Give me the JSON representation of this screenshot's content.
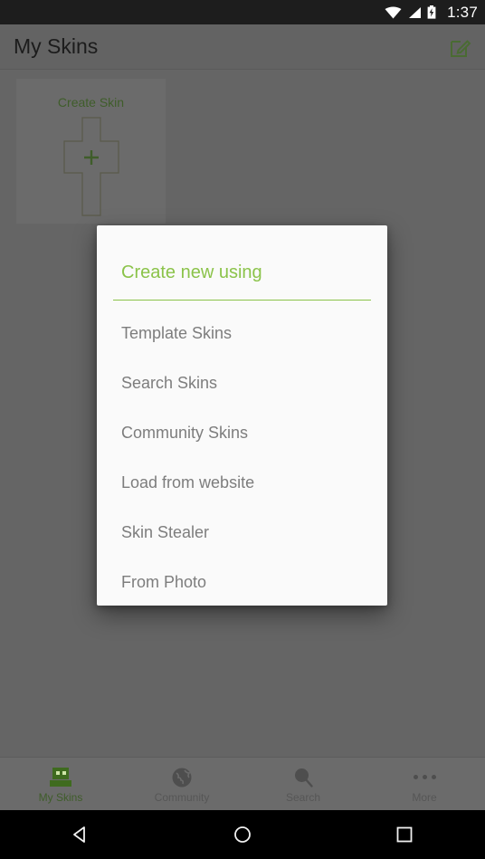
{
  "status_bar": {
    "time": "1:37",
    "icons": [
      "wifi-icon",
      "cell-signal-icon",
      "battery-charging-icon"
    ]
  },
  "app_bar": {
    "title": "My Skins",
    "action_icon": "compose-edit-icon"
  },
  "content": {
    "create_skin_card": {
      "label": "Create Skin",
      "icon": "skin-template-plus-icon"
    }
  },
  "dialog": {
    "title": "Create new using",
    "accent_color": "#8BC34A",
    "items": [
      {
        "label": "Template Skins"
      },
      {
        "label": "Search Skins"
      },
      {
        "label": "Community Skins"
      },
      {
        "label": "Load from website"
      },
      {
        "label": "Skin Stealer"
      },
      {
        "label": "From Photo"
      }
    ]
  },
  "bottom_nav": {
    "active_index": 0,
    "tabs": [
      {
        "label": "My Skins",
        "icon": "minecraft-head-icon"
      },
      {
        "label": "Community",
        "icon": "globe-icon"
      },
      {
        "label": "Search",
        "icon": "magnifier-icon"
      },
      {
        "label": "More",
        "icon": "overflow-dots-icon"
      }
    ]
  },
  "android_nav": {
    "buttons": [
      {
        "icon": "back-triangle-icon"
      },
      {
        "icon": "home-circle-icon"
      },
      {
        "icon": "recents-square-icon"
      }
    ]
  }
}
